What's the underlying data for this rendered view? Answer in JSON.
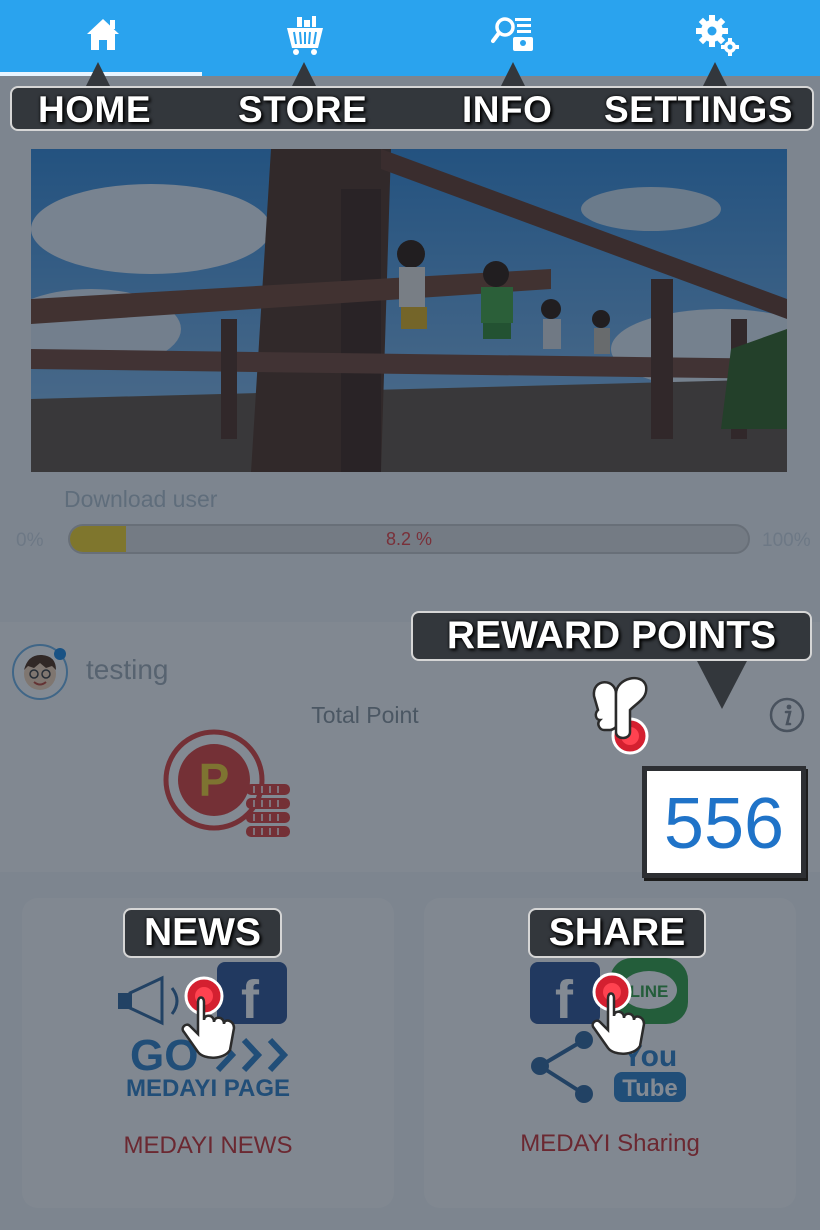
{
  "nav": {
    "tabs": [
      {
        "label": "HOME",
        "icon": "home-icon",
        "active": true
      },
      {
        "label": "STORE",
        "icon": "shopping-basket-icon",
        "active": false
      },
      {
        "label": "INFO",
        "icon": "search-document-icon",
        "active": false
      },
      {
        "label": "SETTINGS",
        "icon": "gears-icon",
        "active": false
      }
    ]
  },
  "download": {
    "label": "Download user",
    "min_label": "0%",
    "max_label": "100%",
    "percent_text": "8.2 %",
    "progress": 0.082
  },
  "profile": {
    "username": "testing",
    "total_point_label": "Total Point"
  },
  "cards": {
    "news_caption": "MEDAYI NEWS",
    "news_art_line1": "GO",
    "news_art_line2": "MEDAYI PAGE",
    "share_caption": "MEDAYI Sharing",
    "share_art_line": "LINE",
    "share_art_you": "You",
    "share_art_tube": "Tube"
  },
  "tutorial": {
    "reward_tag": "REWARD POINTS",
    "news_tag": "NEWS",
    "share_tag": "SHARE",
    "points_value": "556"
  },
  "colors": {
    "topbar": "#2aa3ee",
    "accent_red": "#cf3b3b",
    "points_blue": "#1f73c8",
    "progress_yellow": "#f6d633"
  }
}
